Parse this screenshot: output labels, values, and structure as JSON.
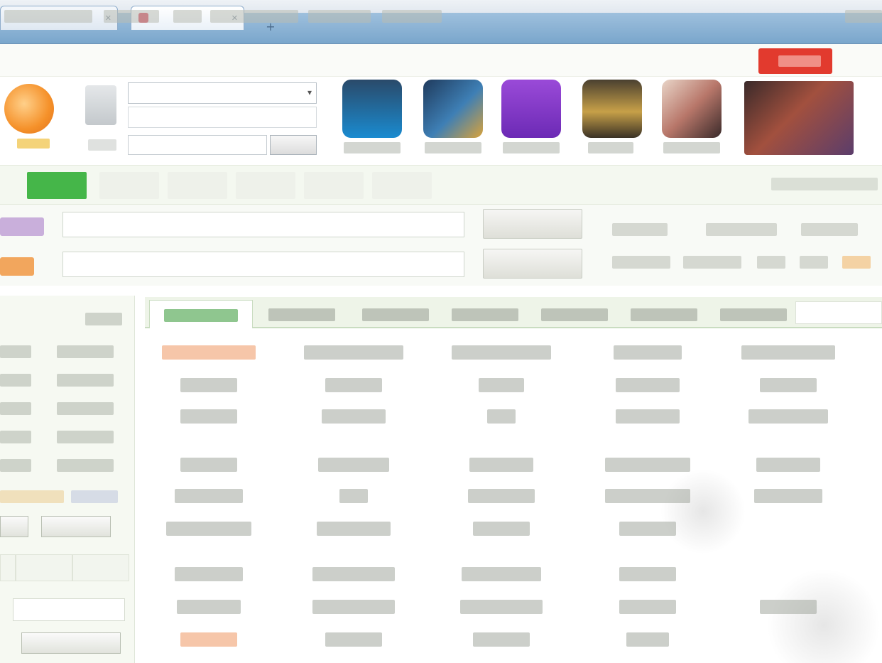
{
  "browser": {
    "tabs": [
      {
        "label": ""
      },
      {
        "label": ""
      }
    ],
    "new_tab": "+"
  },
  "top_links": [],
  "header": {
    "select_value": "",
    "search_button": "",
    "apps": []
  },
  "nav": {
    "tabs": [],
    "right_text": ""
  },
  "search": {
    "buttons": [
      "",
      ""
    ],
    "hot_words": []
  },
  "sidebar": {
    "title": "",
    "items": [],
    "buttons": [],
    "tabs": [],
    "input_value": "",
    "bottom_button": ""
  },
  "content": {
    "tabs": [],
    "links": []
  },
  "colors": {
    "accent_green": "#45b649",
    "badge_red": "#e23a2e",
    "tabbar_blue": "#7aa6cc"
  }
}
